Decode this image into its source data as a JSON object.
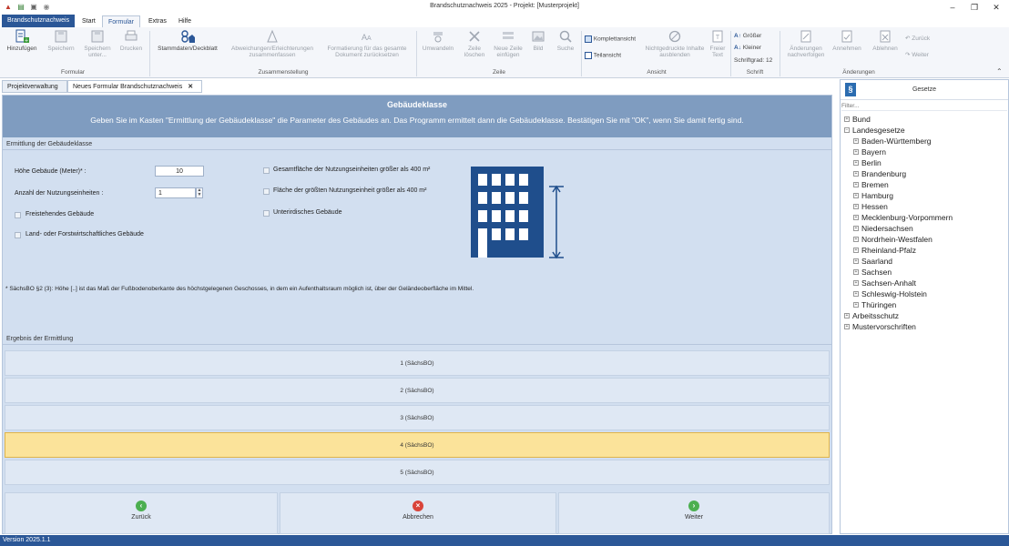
{
  "window": {
    "title": "Brandschutznachweis 2025 - Projekt: [Musterprojekt]"
  },
  "ribbon_tabs": [
    "Brandschutznachweis",
    "Start",
    "Formular",
    "Extras",
    "Hilfe"
  ],
  "ribbon": {
    "formular": {
      "hinzufuegen": "Hinzufügen",
      "speichern": "Speichern",
      "speichern_unter": "Speichern unter...",
      "drucken": "Drucken",
      "group": "Formular"
    },
    "zusammenstellung": {
      "stammdaten": "Stammdaten/Deckblatt",
      "abweichungen": "Abweichungen/Erleichterungen zusammenfassen",
      "formatierung": "Formatierung für das gesamte Dokument zurücksetzen",
      "group": "Zusammenstellung"
    },
    "zeile": {
      "umwandeln": "Umwandeln",
      "zeile_loeschen": "Zeile löschen",
      "neue_zeile": "Neue Zeile einfügen",
      "bild": "Bild",
      "suche": "Suche",
      "group": "Zeile"
    },
    "ansicht": {
      "komplettansicht": "Komplettansicht",
      "teilansicht": "Teilansicht",
      "nichtgedruckte": "Nichtgedruckte Inhalte ausblenden",
      "freier_text": "Freier Text",
      "group": "Ansicht"
    },
    "schrift": {
      "groesser": "Größer",
      "kleiner": "Kleiner",
      "schriftgrad": "Schriftgrad: 12",
      "group": "Schrift"
    },
    "aenderungen": {
      "nachverfolgen": "Änderungen nachverfolgen",
      "annehmen": "Annehmen",
      "ablehnen": "Ablehnen",
      "zurueck": "Zurück",
      "weiter": "Weiter",
      "group": "Änderungen"
    }
  },
  "doc_tabs": {
    "projektverwaltung": "Projektverwaltung",
    "neues_formular": "Neues Formular Brandschutznachweis"
  },
  "form": {
    "title": "Gebäudeklasse",
    "subtitle": "Geben Sie im Kasten \"Ermittlung der Gebäudeklasse\" die Parameter des Gebäudes an. Das Programm ermittelt dann die Gebäudeklasse. Bestätigen Sie mit \"OK\", wenn Sie damit fertig sind.",
    "section_ermittlung": "Ermittlung der Gebäudeklasse",
    "hoehe_label": "Höhe Gebäude (Meter)* :",
    "hoehe_value": "10",
    "anzahl_label": "Anzahl der Nutzungseinheiten :",
    "anzahl_value": "1",
    "freistehend": "Freistehendes Gebäude",
    "landwirtschaft": "Land- oder Forstwirtschaftliches Gebäude",
    "gesamtflaeche": "Gesamtfläche der Nutzungseinheiten größer als 400 m²",
    "flaeche_groesste": "Fläche der größten Nutzungseinheit größer als 400 m²",
    "unterirdisch": "Unterirdisches Gebäude",
    "note": "* SächsBO §2 (3): Höhe [..] ist das Maß der Fußbodenoberkante des höchstgelegenen Geschosses, in dem ein Aufenthaltsraum möglich ist, über der Geländeoberfläche im Mittel.",
    "section_ergebnis": "Ergebnis der Ermittlung",
    "results": [
      "1 (SächsBO)",
      "2 (SächsBO)",
      "3 (SächsBO)",
      "4 (SächsBO)",
      "5 (SächsBO)"
    ],
    "selected_result": "4 (SächsBO)",
    "nav": {
      "zurueck": "Zurück",
      "abbrechen": "Abbrechen",
      "weiter": "Weiter"
    }
  },
  "gesetze": {
    "title": "Gesetze",
    "filter": "Filter...",
    "tree": {
      "bund": "Bund",
      "landesgesetze": "Landesgesetze",
      "laender": [
        "Baden-Württemberg",
        "Bayern",
        "Berlin",
        "Brandenburg",
        "Bremen",
        "Hamburg",
        "Hessen",
        "Mecklenburg-Vorpommern",
        "Niedersachsen",
        "Nordrhein-Westfalen",
        "Rheinland-Pfalz",
        "Saarland",
        "Sachsen",
        "Sachsen-Anhalt",
        "Schleswig-Holstein",
        "Thüringen"
      ],
      "arbeitsschutz": "Arbeitsschutz",
      "mustervorschriften": "Mustervorschriften"
    }
  },
  "status": {
    "version": "Version 2025.1.1"
  },
  "colors": {
    "accent": "#2b5797",
    "header": "#7f9cc0",
    "form_bg": "#d2dff0",
    "selected": "#fbe39a",
    "building": "#1f4e8c"
  }
}
